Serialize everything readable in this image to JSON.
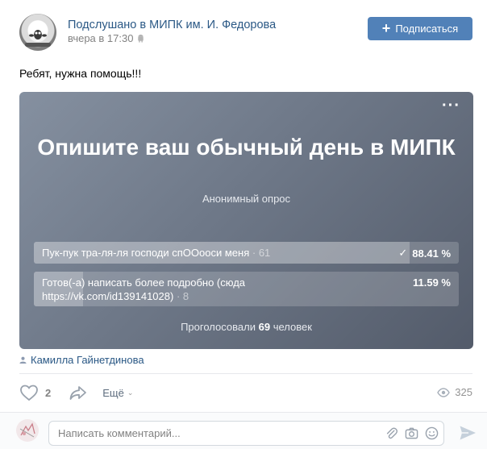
{
  "post": {
    "group_name": "Подслушано в МИПК им. И. Федорова",
    "time": "вчера в 17:30",
    "subscribe_label": "Подписаться",
    "text": "Ребят, нужна помощь!!!"
  },
  "poll": {
    "title": "Опишите ваш обычный день в МИПК",
    "type": "Анонимный опрос",
    "options": [
      {
        "label": "Пук-пук тра-ля-ля господи спООооси меня",
        "count": "61",
        "percent": "88.41 %",
        "fraction": 0.8841,
        "voted": true
      },
      {
        "label": "Готов(-а) написать более подробно (сюда https://vk.com/id139141028)",
        "count": "8",
        "percent": "11.59 %",
        "fraction": 0.1159,
        "voted": false
      }
    ],
    "total_prefix": "Проголосовали",
    "total_count": "69",
    "total_suffix": "человек"
  },
  "signer": "Камилла Гайнетдинова",
  "actions": {
    "likes": "2",
    "more_label": "Ещё",
    "views": "325"
  },
  "comment": {
    "placeholder": "Написать комментарий..."
  },
  "icons": [
    "android-icon",
    "plus-icon",
    "more-dots-icon",
    "check-icon",
    "person-icon",
    "heart-icon",
    "share-icon",
    "chevron-down-icon",
    "eye-icon",
    "attach-icon",
    "camera-icon",
    "emoji-icon",
    "send-icon"
  ],
  "colors": {
    "link": "#2a5885",
    "button": "#5181b8",
    "muted": "#828282"
  }
}
